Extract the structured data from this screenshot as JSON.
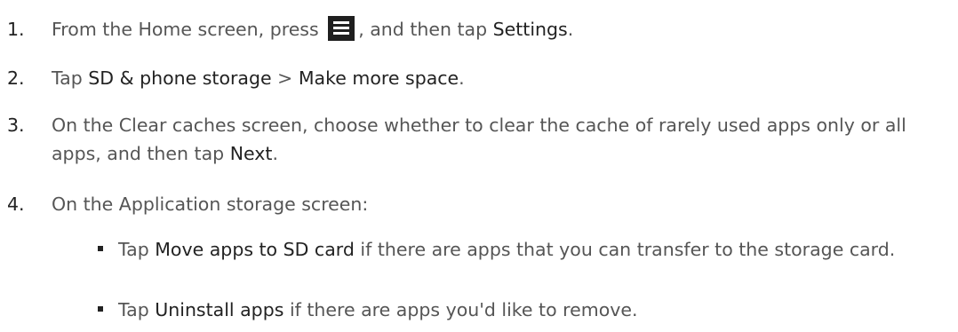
{
  "steps": [
    {
      "num": "1.",
      "t1": "From the Home screen, press",
      "t2": ", and then tap",
      "b1": "Settings",
      "t3": "."
    },
    {
      "num": "2.",
      "t1": "Tap",
      "b1": "SD & phone storage",
      "t2": ">",
      "b2": "Make more space",
      "t3": "."
    },
    {
      "num": "3.",
      "t1": "On the Clear caches screen, choose whether to clear the cache of rarely used apps only or all apps, and then tap",
      "b1": "Next",
      "t2": "."
    },
    {
      "num": "4.",
      "t1": "On the Application storage screen:"
    }
  ],
  "bullets": [
    {
      "t1": "Tap",
      "b1": "Move apps to SD card",
      "t2": "if there are apps that you can transfer to the storage card."
    },
    {
      "t1": "Tap",
      "b1": "Uninstall apps",
      "t2": "if there are apps you'd like to remove."
    }
  ],
  "icons": {
    "menu": "menu-icon"
  }
}
